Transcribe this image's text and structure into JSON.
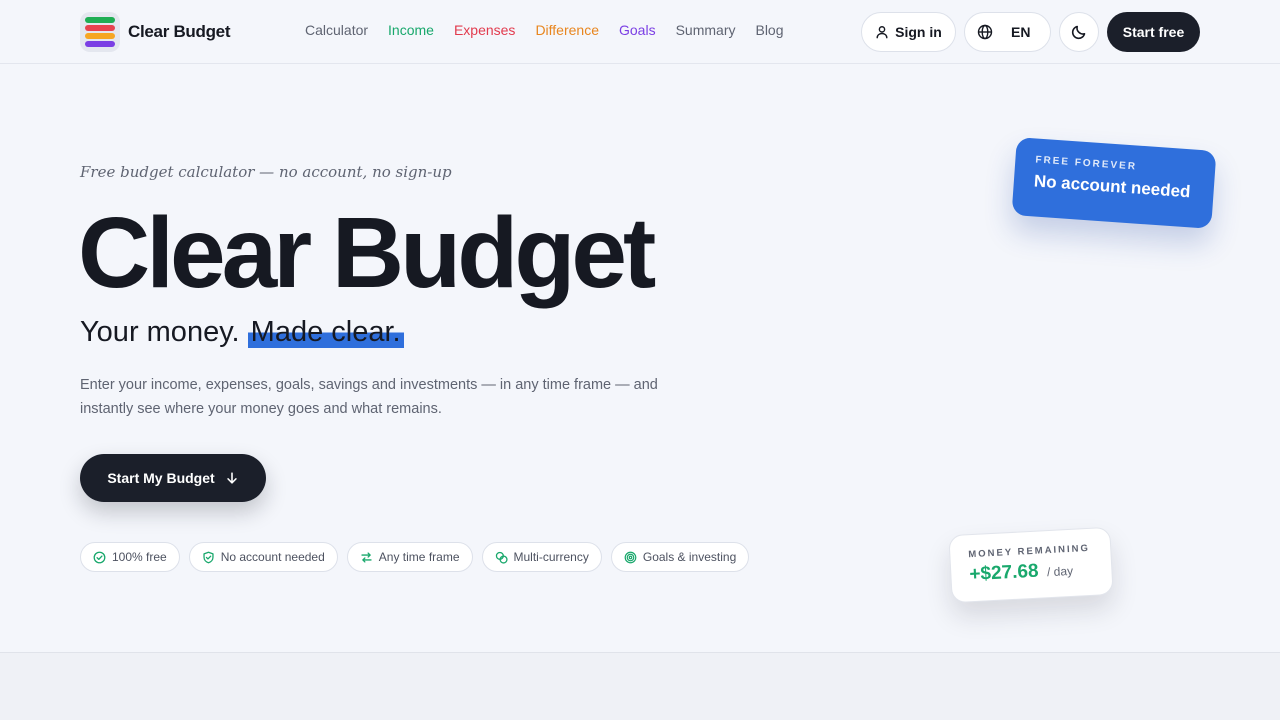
{
  "brand": {
    "name": "Clear Budget",
    "logo_colors": [
      "#1fae54",
      "#e8434f",
      "#f6a623",
      "#7b3fe4"
    ]
  },
  "nav": {
    "items": [
      {
        "label": "Calculator",
        "color": "#5f6472"
      },
      {
        "label": "Income",
        "color": "#19a86c"
      },
      {
        "label": "Expenses",
        "color": "#e23b4e"
      },
      {
        "label": "Difference",
        "color": "#e8861f"
      },
      {
        "label": "Goals",
        "color": "#7b3fe4"
      },
      {
        "label": "Summary",
        "color": "#5f6472"
      },
      {
        "label": "Blog",
        "color": "#5f6472"
      }
    ]
  },
  "header": {
    "signin_label": "Sign in",
    "language": "EN",
    "start_label": "Start free"
  },
  "hero": {
    "tagline": "Free budget calculator — no account, no sign-up",
    "title": "Clear Budget",
    "subtitle_plain": "Your money.",
    "subtitle_highlight": "Made clear.",
    "description": "Enter your income, expenses, goals, savings and investments — in any time frame — and instantly see where your money goes and what remains.",
    "cta_label": "Start My Budget"
  },
  "features": [
    {
      "label": "100% free",
      "icon": "check-circle-icon"
    },
    {
      "label": "No account needed",
      "icon": "shield-check-icon"
    },
    {
      "label": "Any time frame",
      "icon": "swap-arrows-icon"
    },
    {
      "label": "Multi-currency",
      "icon": "coins-icon"
    },
    {
      "label": "Goals & investing",
      "icon": "target-icon"
    }
  ],
  "cards": {
    "free": {
      "kicker": "FREE FOREVER",
      "text": "No account needed"
    },
    "money": {
      "kicker": "MONEY REMAINING",
      "value": "+$27.68",
      "unit": "/ day"
    }
  },
  "colors": {
    "accent_blue": "#2f6fdc",
    "dark": "#1b1f2a",
    "positive_green": "#19a86c",
    "background": "#f4f6fb"
  }
}
